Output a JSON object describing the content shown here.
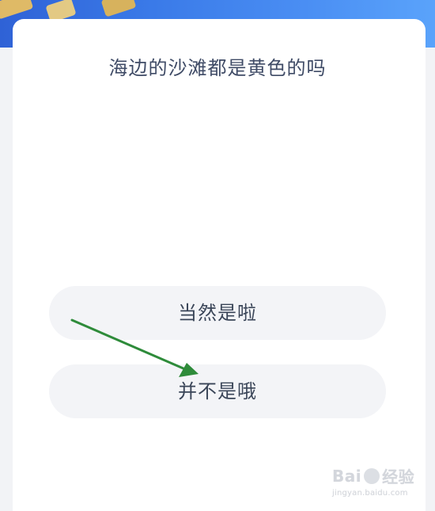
{
  "question": {
    "text": "海边的沙滩都是黄色的吗"
  },
  "options": [
    {
      "label": "当然是啦"
    },
    {
      "label": "并不是哦"
    }
  ],
  "watermark": {
    "brand_prefix": "Bai",
    "brand_suffix": "经验",
    "site": "jingyan.baidu.com"
  },
  "colors": {
    "banner_blue": "#3a7ae8",
    "card_bg": "#ffffff",
    "option_bg": "#f3f4f7",
    "question_text": "#3f4b66",
    "arrow_green": "#2e8b3a"
  }
}
